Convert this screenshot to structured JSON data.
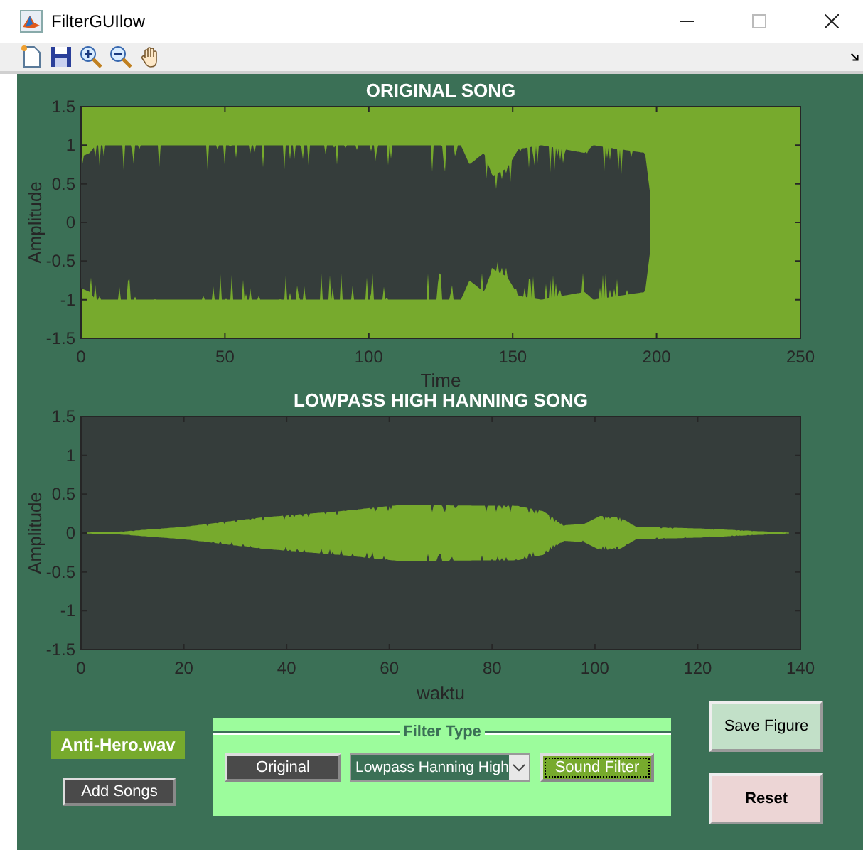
{
  "window": {
    "title": "FilterGUIlow"
  },
  "plots": [
    {
      "kind": "original",
      "title": "ORIGINAL SONG",
      "ylabel": "Amplitude",
      "xlabel": "Time",
      "xticks": [
        "0",
        "50",
        "100",
        "150",
        "200",
        "250"
      ],
      "yticks": [
        "1.5",
        "1",
        "0.5",
        "0",
        "-0.5",
        "-1",
        "-1.5"
      ]
    },
    {
      "kind": "filtered",
      "title": "LOWPASS HIGH HANNING SONG",
      "ylabel": "Amplitude",
      "xlabel": "waktu",
      "xticks": [
        "0",
        "20",
        "40",
        "60",
        "80",
        "100",
        "120",
        "140"
      ],
      "yticks": [
        "1.5",
        "1",
        "0.5",
        "0",
        "-0.5",
        "-1",
        "-1.5"
      ]
    }
  ],
  "song_label": "Anti-Hero.wav",
  "add_button": "Add Songs",
  "filter_panel": {
    "title": "Filter Type",
    "original_button": "Original",
    "filter_select": {
      "value": "Lowpass Hanning High"
    },
    "apply_button": {
      "label": "Sound Filter",
      "focused": true
    }
  },
  "save_button": "Save Figure",
  "reset_button": "Reset"
}
